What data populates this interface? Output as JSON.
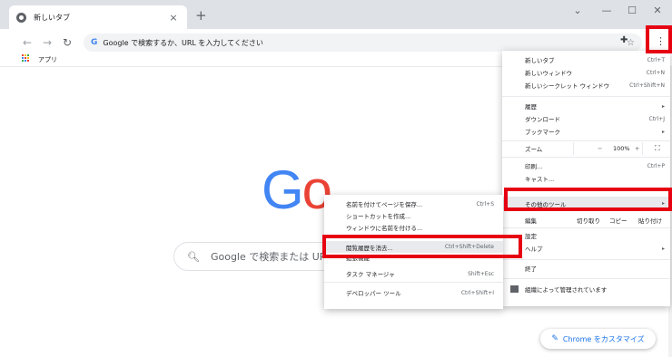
{
  "tab": {
    "title": "新しいタブ",
    "close": "×"
  },
  "new_tab_symbol": "+",
  "window": {
    "minimize": "—",
    "maximize": "☐",
    "close": "✕",
    "dropdown": "⌄"
  },
  "toolbar": {
    "back": "←",
    "forward": "→",
    "reload": "↻",
    "omnibox_g": "G",
    "omnibox_placeholder": "Google で検索するか、URL を入力してください",
    "star": "☆",
    "extensions": "✚",
    "menu": "⋮"
  },
  "bookmarks": {
    "apps_label": "アプリ"
  },
  "google": {
    "logo_letters": [
      {
        "ch": "G",
        "color": "#4285f4"
      },
      {
        "ch": "o",
        "color": "#ea4335"
      }
    ],
    "search_placeholder": "Google で検索または URL を"
  },
  "customize_button": "Chrome をカスタマイズ",
  "main_menu": {
    "items": [
      {
        "label": "新しいタブ",
        "shortcut": "Ctrl+T"
      },
      {
        "label": "新しいウィンドウ",
        "shortcut": "Ctrl+N"
      },
      {
        "label": "新しいシークレット ウィンドウ",
        "shortcut": "Ctrl+Shift+N"
      },
      {
        "label": "履歴",
        "shortcut": "▸"
      },
      {
        "label": "ダウンロード",
        "shortcut": "Ctrl+J"
      },
      {
        "label": "ブックマーク",
        "shortcut": "▸"
      },
      {
        "label": "印刷...",
        "shortcut": "Ctrl+P"
      },
      {
        "label": "キャスト...",
        "shortcut": ""
      },
      {
        "label": "その他のツール",
        "shortcut": "▸"
      },
      {
        "label": "設定",
        "shortcut": ""
      },
      {
        "label": "ヘルプ",
        "shortcut": "▸"
      },
      {
        "label": "終了",
        "shortcut": ""
      }
    ],
    "zoom": {
      "label": "ズーム",
      "minus": "−",
      "value": "100%",
      "plus": "+",
      "fullscreen": "⛶"
    },
    "edit": {
      "label": "編集",
      "cut": "切り取り",
      "copy": "コピー",
      "paste": "貼り付け"
    },
    "managed": "組織によって管理されています"
  },
  "sub_menu": {
    "items": [
      {
        "label": "名前を付けてページを保存...",
        "shortcut": "Ctrl+S"
      },
      {
        "label": "ショートカットを作成...",
        "shortcut": ""
      },
      {
        "label": "ウィンドウに名前を付ける...",
        "shortcut": ""
      },
      {
        "label": "閲覧履歴を消去...",
        "shortcut": "Ctrl+Shift+Delete"
      },
      {
        "label": "拡張機能",
        "shortcut": ""
      },
      {
        "label": "タスク マネージャ",
        "shortcut": "Shift+Esc"
      },
      {
        "label": "デベロッパー ツール",
        "shortcut": "Ctrl+Shift+I"
      }
    ]
  },
  "colors": {
    "annotation_red": "#e60012",
    "apps_grid": [
      "#ea4335",
      "#fbbc05",
      "#34a853",
      "#4285f4",
      "#ea4335",
      "#fbbc05",
      "#34a853",
      "#4285f4",
      "#ea4335"
    ]
  }
}
